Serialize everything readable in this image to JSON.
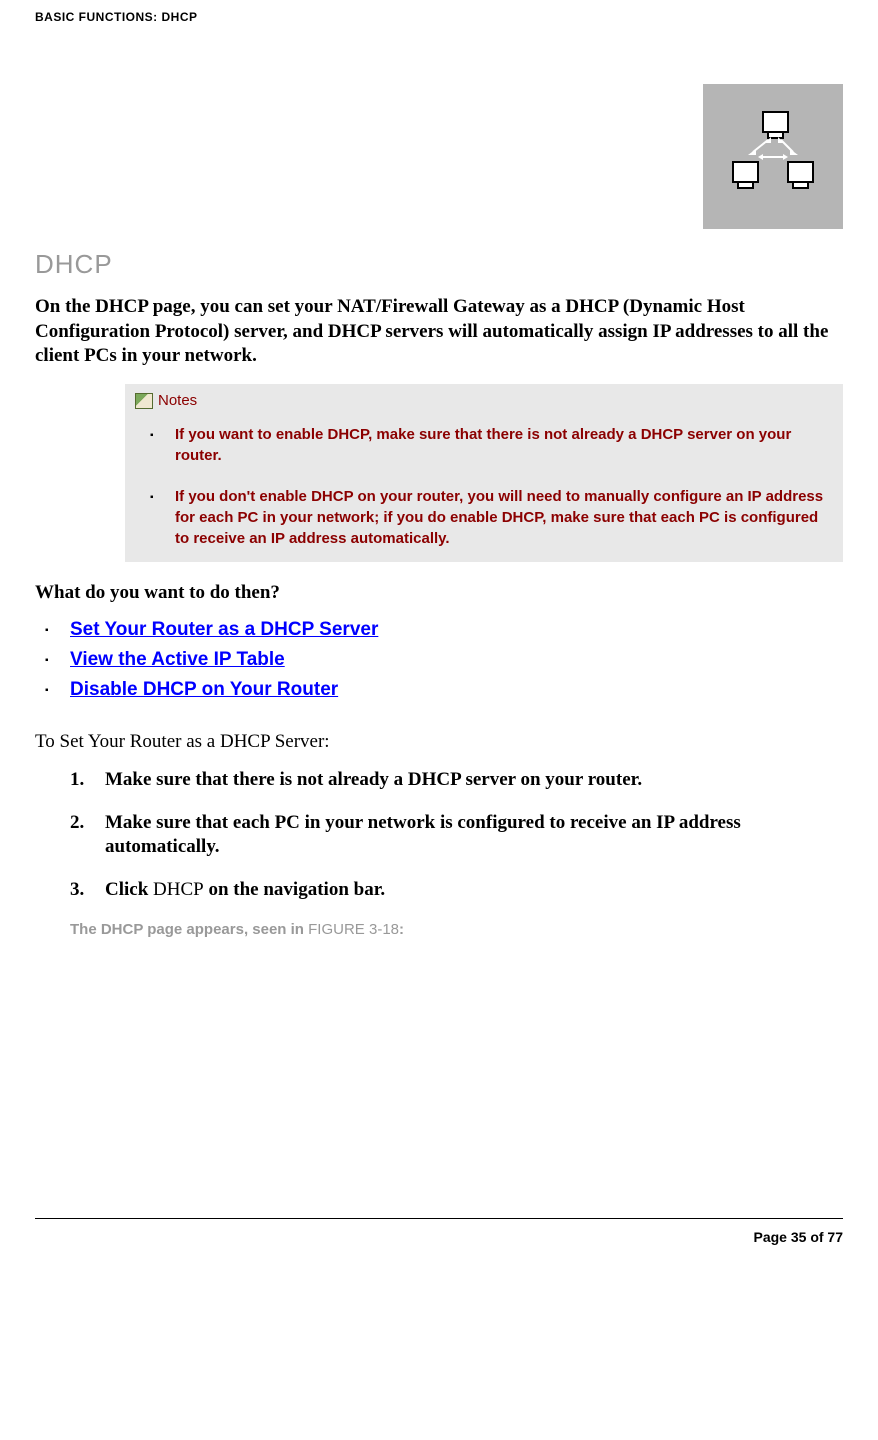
{
  "breadcrumb": "BASIC FUNCTIONS: DHCP",
  "section_title": "DHCP",
  "intro": "On the DHCP page, you can set your NAT/Firewall Gateway as a DHCP (Dynamic Host Configuration Protocol) server, and DHCP servers will automatically assign IP addresses to all the client PCs in your network.",
  "notes": {
    "label": "Notes",
    "items": [
      "If you want to enable DHCP, make sure that there is not already a DHCP server on your router.",
      "If you don't enable DHCP on your router, you will need to manually configure an IP address for each PC in your network; if you do enable DHCP, make sure that each PC is configured to receive an IP address automatically."
    ]
  },
  "question": "What do you want to do then?",
  "links": [
    "Set Your Router as a DHCP Server",
    "View the Active IP Table",
    "Disable DHCP on Your Router"
  ],
  "subsection_title": "To Set Your Router as a DHCP Server:",
  "steps": [
    {
      "bold": "Make sure that there is not already a DHCP server on your router."
    },
    {
      "bold": "Make sure that each PC in your network is configured to receive an IP address automatically."
    },
    {
      "bold_pre": "Click ",
      "normal": "DHCP",
      "bold_post": " on the navigation bar."
    }
  ],
  "figure_note": {
    "text": "The DHCP page appears, seen in ",
    "ref": "FIGURE 3-18",
    "suffix": ":"
  },
  "footer": "Page 35 of 77"
}
